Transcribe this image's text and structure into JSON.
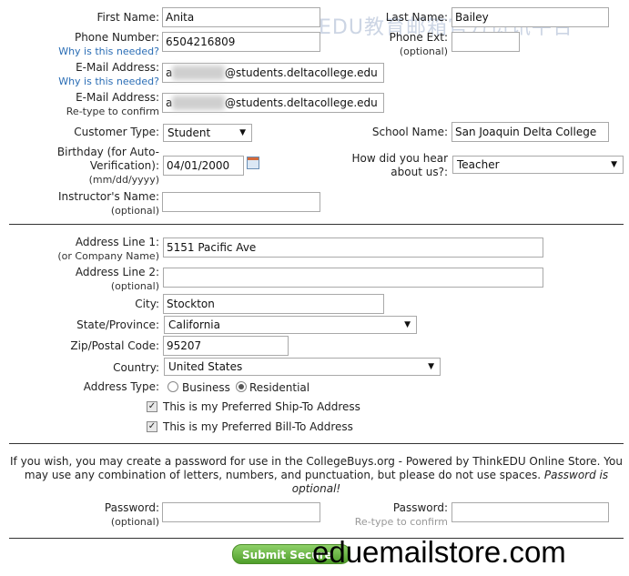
{
  "watermark": {
    "top": "EDU教育邮箱官方资讯平台",
    "bottom": "eduemailstore.com"
  },
  "contact": {
    "first_name_label": "First Name:",
    "first_name_value": "Anita",
    "last_name_label": "Last Name:",
    "last_name_value": "Bailey",
    "phone_label": "Phone Number:",
    "phone_value": "6504216809",
    "why_needed": "Why is this needed?",
    "phone_ext_label": "Phone Ext:",
    "phone_ext_sub": "(optional)",
    "email_label": "E-Mail Address:",
    "email_prefix": "a",
    "email_value": "@students.deltacollege.edu",
    "email_why": "Why is this needed?",
    "email_confirm_label": "E-Mail Address:",
    "email_confirm_sub": "Re-type to confirm",
    "customer_type_label": "Customer Type:",
    "customer_type_value": "Student",
    "school_label": "School Name:",
    "school_value": "San Joaquin Delta College",
    "birthday_label_1": "Birthday (for Auto-",
    "birthday_label_2": "Verification):",
    "birthday_sub": "(mm/dd/yyyy)",
    "birthday_value": "04/01/2000",
    "hear_label_1": "How did you hear",
    "hear_label_2": "about us?:",
    "hear_value": "Teacher",
    "instructor_label": "Instructor's Name:",
    "instructor_sub": "(optional)"
  },
  "address": {
    "line1_label": "Address Line 1:",
    "line1_sub": "(or Company Name)",
    "line1_value": "5151 Pacific Ave",
    "line2_label": "Address Line 2:",
    "line2_sub": "(optional)",
    "city_label": "City:",
    "city_value": "Stockton",
    "state_label": "State/Province:",
    "state_value": "California",
    "zip_label": "Zip/Postal Code:",
    "zip_value": "95207",
    "country_label": "Country:",
    "country_value": "United States",
    "type_label": "Address Type:",
    "type_business": "Business",
    "type_residential": "Residential",
    "ship_label": "This is my Preferred Ship-To Address",
    "bill_label": "This is my Preferred Bill-To Address"
  },
  "password": {
    "info_1": "If you wish, you may create a password for use in the CollegeBuys.org - Powered by ThinkEDU Online Store. You",
    "info_2": "may use any combination of letters, numbers, and punctuation, but please do not use spaces.",
    "info_2_italic": "Password is",
    "info_3": "optional!",
    "label": "Password:",
    "label_sub": "(optional)",
    "confirm_label": "Password:",
    "confirm_sub": "Re-type to confirm",
    "submit_label": "Submit Secure"
  }
}
